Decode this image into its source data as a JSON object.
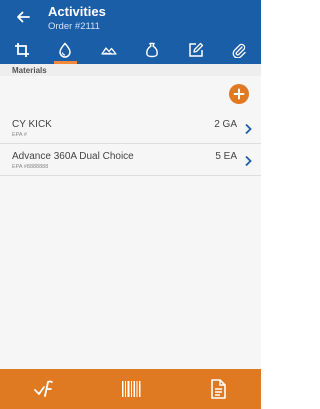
{
  "header": {
    "title": "Activities",
    "subtitle": "Order #2111"
  },
  "tabs": [
    {
      "icon": "crop-icon",
      "active": false
    },
    {
      "icon": "droplet-icon",
      "active": true
    },
    {
      "icon": "terrain-icon",
      "active": false
    },
    {
      "icon": "bag-icon",
      "active": false
    },
    {
      "icon": "edit-icon",
      "active": false
    },
    {
      "icon": "attachment-icon",
      "active": false
    }
  ],
  "section": {
    "label": "Materials"
  },
  "materials": [
    {
      "name": "CY KICK",
      "epa": "EPA #",
      "qty": "2 GA"
    },
    {
      "name": "Advance 360A Dual Choice",
      "epa": "EPA #8888888",
      "qty": "5 EA"
    }
  ],
  "colors": {
    "header": "#1b5ea8",
    "accent": "#e07a22",
    "tab_indicator": "#f08a3a"
  }
}
